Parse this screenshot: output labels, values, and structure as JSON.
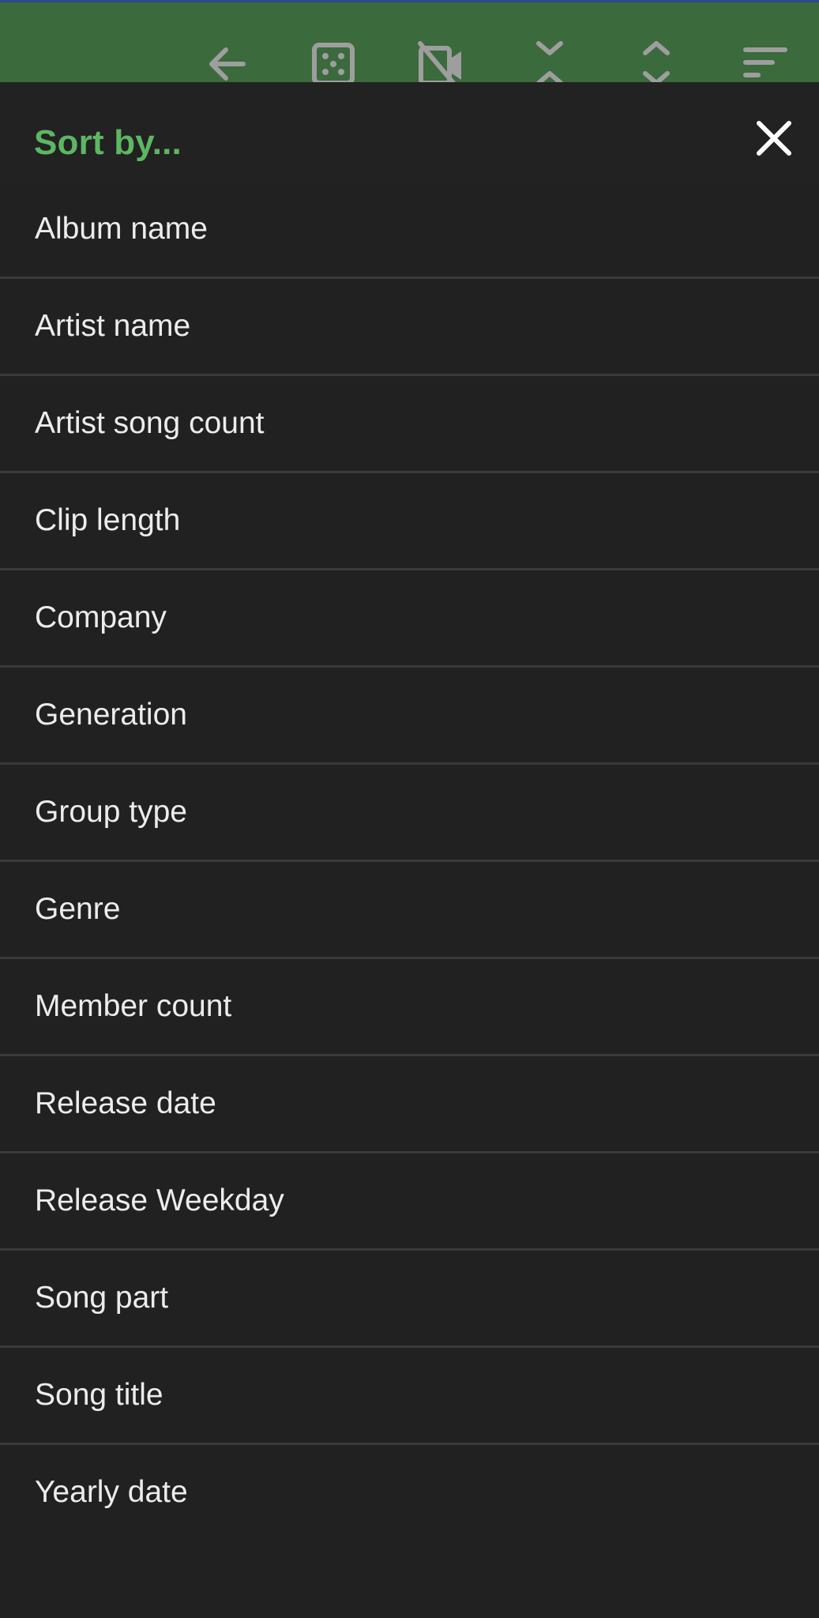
{
  "toolbar": {
    "background": "#3b6a3c",
    "icon_color": "#9e9e9e",
    "icons": [
      {
        "name": "back-arrow-icon"
      },
      {
        "name": "dice-shuffle-icon"
      },
      {
        "name": "video-off-icon"
      },
      {
        "name": "collapse-icon"
      },
      {
        "name": "expand-icon"
      },
      {
        "name": "sort-icon"
      }
    ]
  },
  "sort_sheet": {
    "title": "Sort by...",
    "title_color": "#5eb663",
    "close_icon": "close-icon",
    "options": [
      "Album name",
      "Artist name",
      "Artist song count",
      "Clip length",
      "Company",
      "Generation",
      "Group type",
      "Genre",
      "Member count",
      "Release date",
      "Release Weekday",
      "Song part",
      "Song title",
      "Yearly date"
    ]
  }
}
